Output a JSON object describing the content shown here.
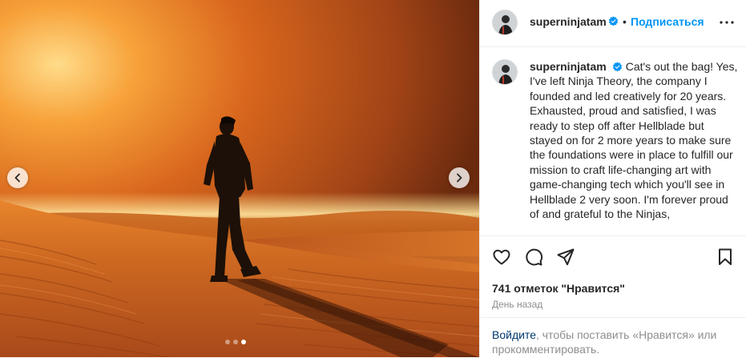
{
  "post": {
    "media": {
      "image_description_icon": "man-in-desert-photo",
      "carousel": {
        "dot_count": 3,
        "active_index": 2
      },
      "prev_icon": "chevron-left-icon",
      "next_icon": "chevron-right-icon"
    },
    "header": {
      "username": "superninjatam",
      "verified": true,
      "separator": "•",
      "follow_label": "Подписаться",
      "more_icon": "more-horizontal-icon"
    },
    "caption": {
      "username": "superninjatam",
      "text": "Cat's out the bag! Yes, I've left Ninja Theory, the company I founded and led creatively for 20 years. Exhausted, proud and satisfied, I was ready to step off after Hellblade but stayed on for 2 more years to make sure the foundations were in place to fulfill our mission to craft life-changing art with game-changing tech which you'll see in Hellblade 2 very soon. I'm forever proud of and grateful to the Ninjas,"
    },
    "actions": {
      "like_icon": "heart-icon",
      "comment_icon": "comment-icon",
      "share_icon": "paper-plane-icon",
      "save_icon": "bookmark-icon"
    },
    "likes_text": "741 отметок \"Нравится\"",
    "time_ago": "День назад",
    "login_prompt": {
      "link": "Войдите",
      "rest": ", чтобы поставить «Нравится» или прокомментировать."
    },
    "colors": {
      "accent": "#0095f6",
      "verified": "#0095f6",
      "link_dark": "#00376b",
      "muted": "#8e8e8e"
    }
  }
}
